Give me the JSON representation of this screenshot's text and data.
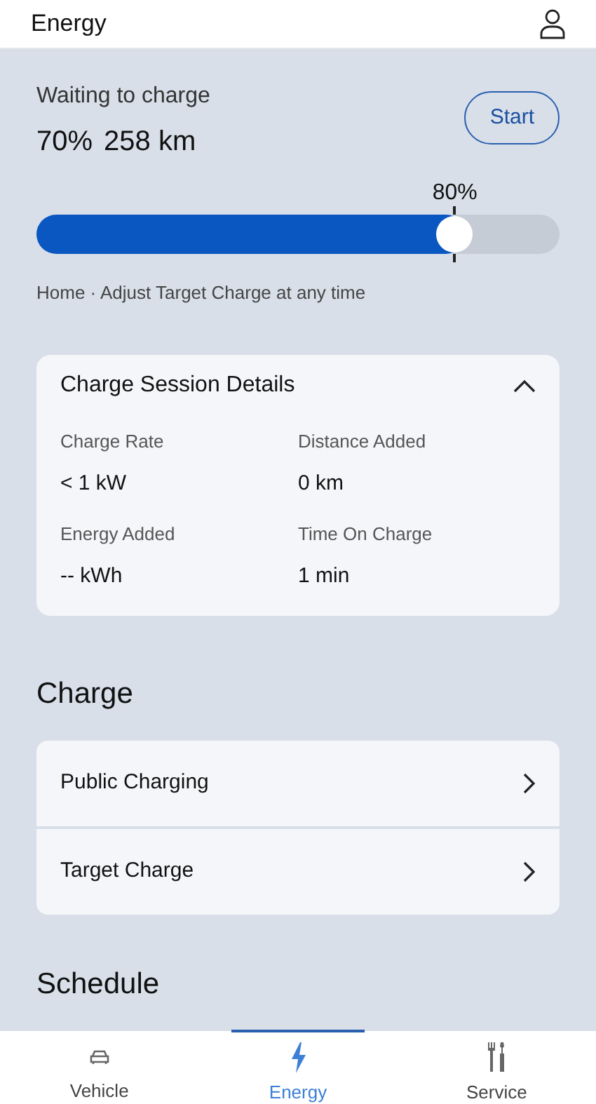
{
  "header": {
    "title": "Energy"
  },
  "status": {
    "label": "Waiting to charge",
    "charge": "70%",
    "range": "258 km",
    "button": "Start"
  },
  "target": {
    "label": "80%",
    "level": 0.8,
    "note": "Home · Adjust Target Charge at any time"
  },
  "session": {
    "title": "Charge Session Details",
    "expanded": true,
    "stats": [
      {
        "label": "Charge Rate",
        "value": "< 1 kW"
      },
      {
        "label": "Distance Added",
        "value": "0 km"
      },
      {
        "label": "Energy Added",
        "value": "-- kWh"
      },
      {
        "label": "Time On Charge",
        "value": "1 min"
      }
    ]
  },
  "charge": {
    "heading": "Charge",
    "items": [
      "Public Charging",
      "Target Charge"
    ]
  },
  "schedule": {
    "heading": "Schedule"
  },
  "nav": [
    {
      "label": "Vehicle",
      "kind": "car",
      "selected": false
    },
    {
      "label": "Energy",
      "kind": "bolt",
      "selected": true
    },
    {
      "label": "Service",
      "kind": "tools",
      "selected": false
    }
  ]
}
